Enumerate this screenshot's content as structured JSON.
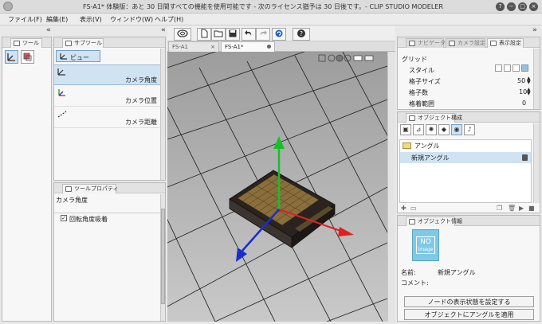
{
  "window": {
    "title": "FS-A1* 体験版：あと 30 日間すべての機能を使用可能です - 次のライセンス猶予は 30 日後です。- CLIP STUDIO MODELER",
    "buttons": [
      "?",
      "−",
      "□",
      "×"
    ]
  },
  "menu": [
    "ファイル(F)",
    "編集(E)",
    "表示(V)",
    "ウィンドウ(W)",
    "ヘルプ(H)"
  ],
  "left": {
    "tool_tab": "ツール",
    "subtool_tab": "サブツール",
    "subtool_group": "ビュー",
    "subtools": [
      "カメラ角度",
      "カメラ位置",
      "カメラ距離"
    ],
    "toolprop_tab": "ツールプロパティ",
    "toolprop_title": "カメラ角度",
    "toolprop_option": "回転角度吸着",
    "toolprop_checked": true
  },
  "canvas": {
    "doc_tabs": [
      "FS-A1",
      "FS-A1*"
    ],
    "close_glyph": "×"
  },
  "right": {
    "tabs": [
      "ナビゲーター",
      "カメラ設定",
      "表示設定"
    ],
    "section": "グリッド",
    "rows": [
      {
        "label": "スタイル",
        "value": ""
      },
      {
        "label": "格子サイズ",
        "value": "50"
      },
      {
        "label": "格子数",
        "value": "10"
      },
      {
        "label": "格着範囲",
        "value": "0"
      }
    ],
    "objtree_tab": "オブジェクト構成",
    "tree_folder": "アングル",
    "tree_item": "新規アングル",
    "objinfo_tab": "オブジェクト情報",
    "thumb_text": "NO",
    "thumb_subtext": "image",
    "name_label": "名前:",
    "name_value": "新規アングル",
    "comment_label": "コメント:",
    "btn_node": "ノードの表示状態を設定する",
    "btn_apply": "オブジェクトにアングルを適用"
  },
  "colors": {
    "accent": "#cfe3f3",
    "axis_x": "#e02020",
    "axis_y": "#18c028",
    "axis_z": "#1a2ecf"
  }
}
